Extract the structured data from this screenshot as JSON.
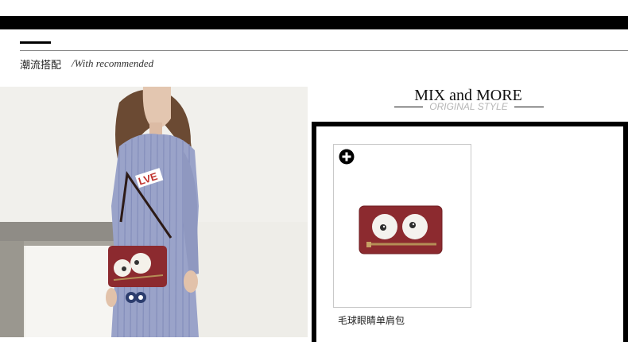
{
  "header": {
    "title": "潮流搭配",
    "subtitle": "/With recommended"
  },
  "showcase": {
    "heading": "MIX and MORE",
    "tagline": "ORIGINAL STYLE"
  },
  "product": {
    "name": "毛球眼睛单肩包",
    "add_icon": "plus-circle-icon",
    "bag_color": "#8c2a2f"
  },
  "colors": {
    "bar": "#000000",
    "tagline": "#b5b5b5"
  }
}
